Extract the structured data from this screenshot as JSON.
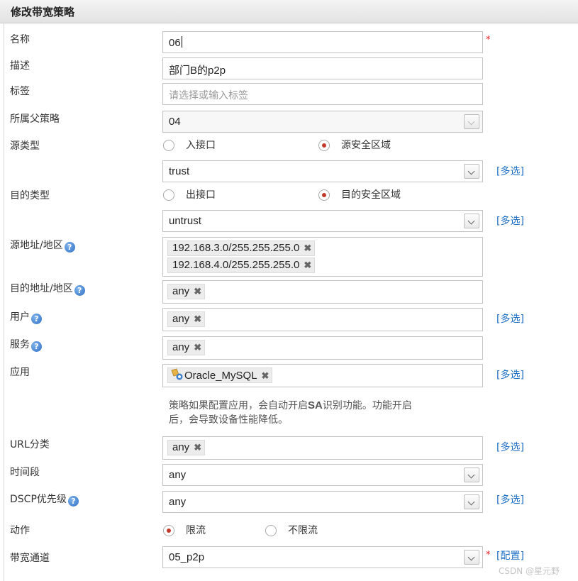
{
  "title": "修改带宽策略",
  "fields": {
    "name": {
      "label": "名称",
      "value": "06"
    },
    "desc": {
      "label": "描述",
      "value": "部门B的p2p"
    },
    "tags": {
      "label": "标签",
      "placeholder": "请选择或输入标签"
    },
    "parent": {
      "label": "所属父策略",
      "value": "04"
    },
    "src_type": {
      "label": "源类型",
      "opt1": "入接口",
      "opt2": "源安全区域",
      "zone": "trust"
    },
    "dst_type": {
      "label": "目的类型",
      "opt1": "出接口",
      "opt2": "目的安全区域",
      "zone": "untrust"
    },
    "src_addr": {
      "label": "源地址/地区",
      "tags": [
        "192.168.3.0/255.255.255.0",
        "192.168.4.0/255.255.255.0"
      ]
    },
    "dst_addr": {
      "label": "目的地址/地区",
      "tag": "any"
    },
    "user": {
      "label": "用户",
      "tag": "any"
    },
    "service": {
      "label": "服务",
      "tag": "any"
    },
    "app": {
      "label": "应用",
      "tag": "Oracle_MySQL",
      "note1": "策略如果配置应用，会自动开启",
      "note_sa": "SA",
      "note2": "识别功能。功能开启",
      "note3": "后，会导致设备性能降低。"
    },
    "url": {
      "label": "URL分类",
      "tag": "any"
    },
    "time": {
      "label": "时间段",
      "value": "any"
    },
    "dscp": {
      "label": "DSCP优先级",
      "value": "any"
    },
    "action": {
      "label": "动作",
      "opt1": "限流",
      "opt2": "不限流"
    },
    "channel": {
      "label": "带宽通道",
      "value": "05_p2p",
      "config": "[配置]"
    }
  },
  "multi_select": "[多选]",
  "help_glyph": "?",
  "remove_glyph": "✖",
  "required_mark": "*",
  "watermark": "CSDN @星元野",
  "colors": {
    "link": "#1f6fc5",
    "required": "#e02020",
    "radio_on": "#c0392b"
  }
}
